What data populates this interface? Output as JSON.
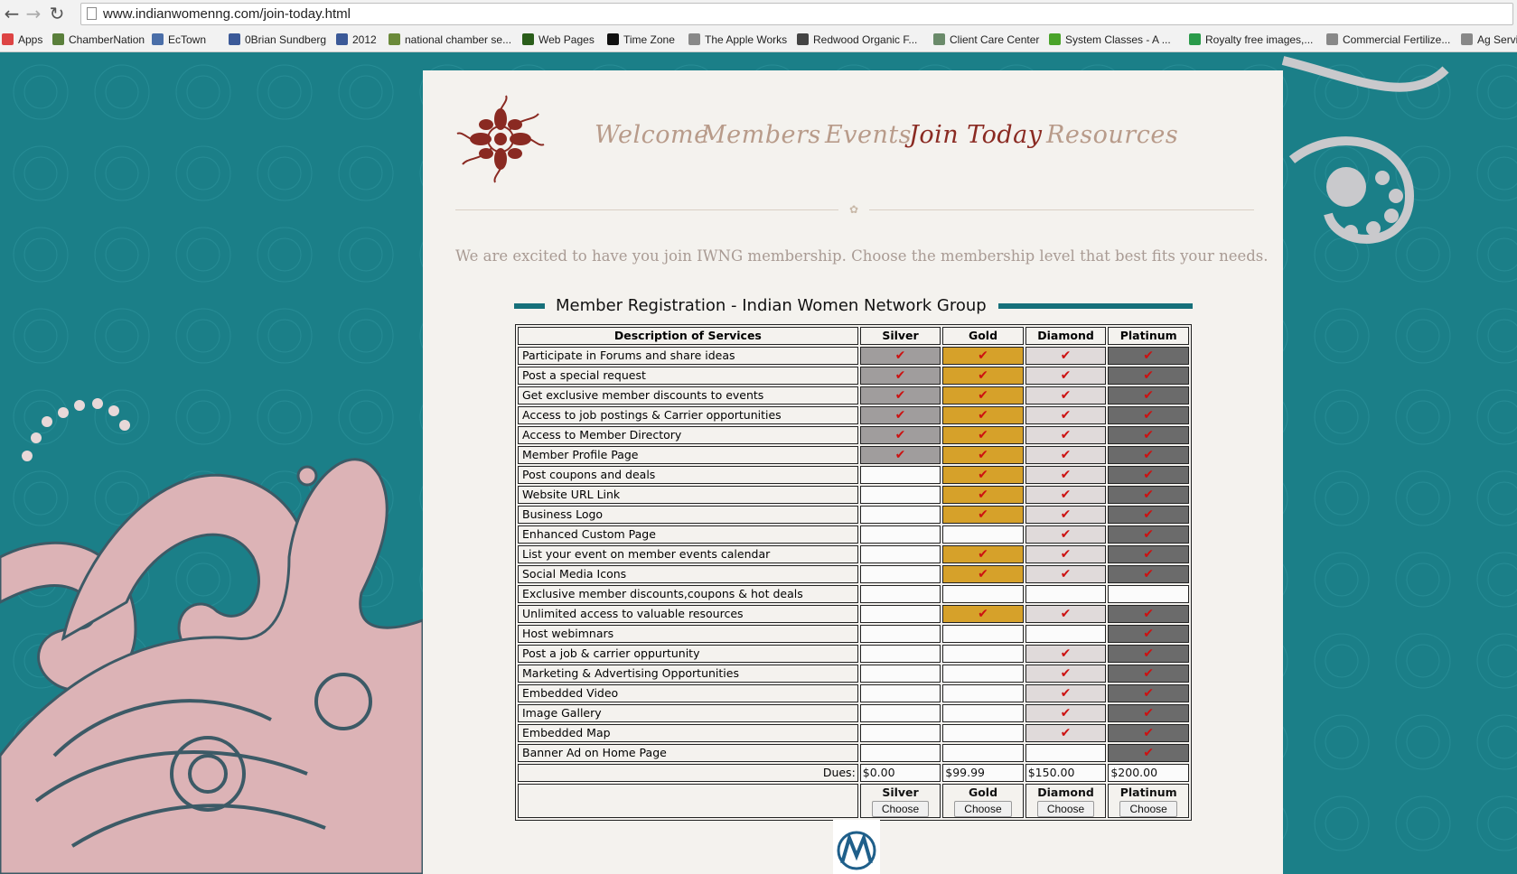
{
  "browser": {
    "url": "www.indianwomenng.com/join-today.html",
    "bookmarks": [
      {
        "label": "Apps",
        "icon": "apps-grid-icon",
        "color": "#d44"
      },
      {
        "label": "ChamberNation",
        "icon": "chamber-icon",
        "color": "#5a7f3b"
      },
      {
        "label": "EcTown",
        "icon": "ectown-icon",
        "color": "#4a6ea8"
      },
      {
        "label": "0Brian Sundberg",
        "icon": "facebook-icon",
        "color": "#3b5998"
      },
      {
        "label": "2012",
        "icon": "facebook-icon",
        "color": "#3b5998"
      },
      {
        "label": "national chamber se...",
        "icon": "chamber-icon",
        "color": "#6b8a3a"
      },
      {
        "label": "Web Pages",
        "icon": "webpages-icon",
        "color": "#2a5d1a"
      },
      {
        "label": "Time Zone",
        "icon": "text-t-icon",
        "color": "#111"
      },
      {
        "label": "The Apple Works",
        "icon": "page-icon",
        "color": "#888"
      },
      {
        "label": "Redwood Organic F...",
        "icon": "redwood-icon",
        "color": "#444"
      },
      {
        "label": "Client Care Center",
        "icon": "client-icon",
        "color": "#6a8a6a"
      },
      {
        "label": "System Classes - A ...",
        "icon": "system-icon",
        "color": "#4aa32a"
      },
      {
        "label": "Royalty free images,...",
        "icon": "royalty-icon",
        "color": "#2a9a4a"
      },
      {
        "label": "Commercial Fertilize...",
        "icon": "page-icon",
        "color": "#888"
      },
      {
        "label": "Ag Servic",
        "icon": "page-icon",
        "color": "#888"
      }
    ]
  },
  "nav": {
    "items": [
      "Welcome",
      "Members",
      "Events",
      "Join Today",
      "Resources"
    ],
    "active": "Join Today"
  },
  "intro_text": "We are excited to have you join IWNG membership.  Choose the membership level that best fits your needs.",
  "registration": {
    "title": "Member Registration - Indian Women Network Group",
    "header_desc": "Description of Services",
    "plans": [
      "Silver",
      "Gold",
      "Diamond",
      "Platinum"
    ],
    "plan_colors": {
      "Silver": "#a09d9d",
      "Gold": "#d6a12a",
      "Diamond": "#e0dada",
      "Platinum": "#6b6b6b"
    },
    "services": [
      {
        "name": "Participate in Forums and share ideas",
        "included": [
          true,
          true,
          true,
          true
        ]
      },
      {
        "name": "Post a special request",
        "included": [
          true,
          true,
          true,
          true
        ]
      },
      {
        "name": "Get exclusive member discounts to events",
        "included": [
          true,
          true,
          true,
          true
        ]
      },
      {
        "name": "Access to job postings & Carrier opportunities",
        "included": [
          true,
          true,
          true,
          true
        ]
      },
      {
        "name": "Access to Member Directory",
        "included": [
          true,
          true,
          true,
          true
        ]
      },
      {
        "name": "Member Profile Page",
        "included": [
          true,
          true,
          true,
          true
        ]
      },
      {
        "name": "Post coupons and deals",
        "included": [
          false,
          true,
          true,
          true
        ]
      },
      {
        "name": "Website URL Link",
        "included": [
          false,
          true,
          true,
          true
        ]
      },
      {
        "name": "Business Logo",
        "included": [
          false,
          true,
          true,
          true
        ]
      },
      {
        "name": "Enhanced Custom Page",
        "included": [
          false,
          false,
          true,
          true
        ]
      },
      {
        "name": "List your event on member events calendar",
        "included": [
          false,
          true,
          true,
          true
        ]
      },
      {
        "name": "Social Media Icons",
        "included": [
          false,
          true,
          true,
          true
        ]
      },
      {
        "name": "Exclusive member discounts,coupons & hot deals",
        "included": [
          false,
          false,
          false,
          false
        ]
      },
      {
        "name": "Unlimited access to valuable resources",
        "included": [
          false,
          true,
          true,
          true
        ]
      },
      {
        "name": "Host webimnars",
        "included": [
          false,
          false,
          false,
          true
        ]
      },
      {
        "name": "Post a job & carrier oppurtunity",
        "included": [
          false,
          false,
          true,
          true
        ]
      },
      {
        "name": "Marketing & Advertising Opportunities",
        "included": [
          false,
          false,
          true,
          true
        ]
      },
      {
        "name": "Embedded Video",
        "included": [
          false,
          false,
          true,
          true
        ]
      },
      {
        "name": "Image Gallery",
        "included": [
          false,
          false,
          true,
          true
        ]
      },
      {
        "name": "Embedded Map",
        "included": [
          false,
          false,
          true,
          true
        ]
      },
      {
        "name": "Banner Ad on Home Page",
        "included": [
          false,
          false,
          false,
          true
        ]
      }
    ],
    "dues_label": "Dues:",
    "dues": [
      "$0.00",
      "$99.99",
      "$150.00",
      "$200.00"
    ],
    "choose_label": "Choose"
  }
}
